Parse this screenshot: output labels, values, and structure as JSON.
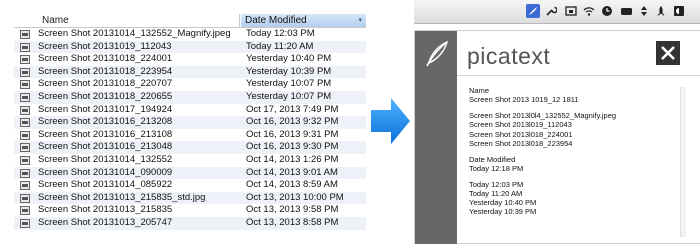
{
  "finder": {
    "col_name": "Name",
    "col_date": "Date Modified",
    "sort_indicator": "▾",
    "rows": [
      {
        "name": "Screen Shot 20131014_132552_Magnify.jpeg",
        "date": "Today 12:03 PM"
      },
      {
        "name": "Screen Shot 20131019_112043",
        "date": "Today 11:20 AM"
      },
      {
        "name": "Screen Shot 20131018_224001",
        "date": "Yesterday 10:40 PM"
      },
      {
        "name": "Screen Shot 20131018_223954",
        "date": "Yesterday 10:39 PM"
      },
      {
        "name": "Screen Shot 20131018_220707",
        "date": "Yesterday 10:07 PM"
      },
      {
        "name": "Screen Shot 20131018_220655",
        "date": "Yesterday 10:07 PM"
      },
      {
        "name": "Screen Shot 20131017_194924",
        "date": "Oct 17, 2013 7:49 PM"
      },
      {
        "name": "Screen Shot 20131016_213208",
        "date": "Oct 16, 2013 9:32 PM"
      },
      {
        "name": "Screen Shot 20131016_213108",
        "date": "Oct 16, 2013 9:31 PM"
      },
      {
        "name": "Screen Shot 20131016_213048",
        "date": "Oct 16, 2013 9:30 PM"
      },
      {
        "name": "Screen Shot 20131014_132552",
        "date": "Oct 14, 2013 1:26 PM"
      },
      {
        "name": "Screen Shot 20131014_090009",
        "date": "Oct 14, 2013 9:01 AM"
      },
      {
        "name": "Screen Shot 20131014_085922",
        "date": "Oct 14, 2013 8:59 AM"
      },
      {
        "name": "Screen Shot 20131013_215835_std.jpg",
        "date": "Oct 13, 2013 10:00 PM"
      },
      {
        "name": "Screen Shot 20131013_215835",
        "date": "Oct 13, 2013 9:58 PM"
      },
      {
        "name": "Screen Shot 20131013_205747",
        "date": "Oct 13, 2013 8:58 PM"
      }
    ]
  },
  "menubar": {
    "icons": [
      "picatext-feather-icon",
      "wrench-icon",
      "screen-icon",
      "wifi-icon",
      "clock-icon",
      "drive-icon",
      "battery-icon",
      "rocket-icon",
      "contrast-icon"
    ]
  },
  "picatext": {
    "title": "picatext",
    "close_symbol": "✕",
    "ocr_lines": [
      "Name",
      "Screen Shot 2013 1019_12 1811",
      "",
      "Screen Shot 2013l0l4_132552_Magnify.jpeg",
      "Screen Shot 2013l019_112043",
      "Screen Shot 2013l018_224001",
      "Screen Shot 2013l018_223954",
      "",
      "Date Modified",
      "Today 12:18 PM",
      "",
      "Today 12:03 PM",
      "Today 11:20 AM",
      "Yesterday 10:40 PM",
      "Yesterday 10:39 PM"
    ]
  },
  "colors": {
    "arrow": "#1e90ff",
    "header_selected": "#b2cdee",
    "sidebar": "#676767",
    "menubar_active": "#3d6bd6"
  }
}
